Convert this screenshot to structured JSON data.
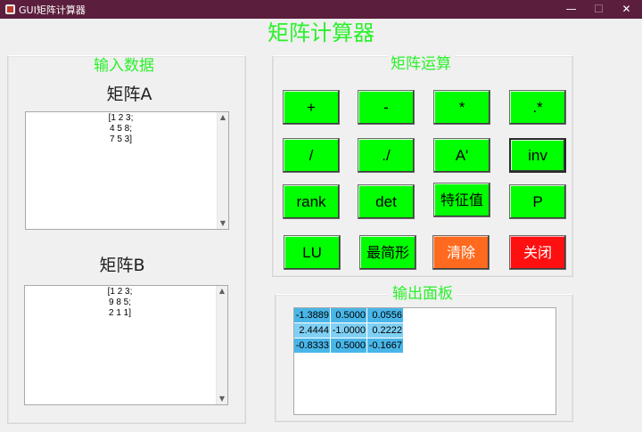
{
  "window": {
    "title": "GUI矩阵计算器",
    "minimize": "—",
    "maximize": "☐",
    "close": "✕"
  },
  "header": {
    "title": "矩阵计算器"
  },
  "input_panel": {
    "title": "输入数据",
    "matrixA_label": "矩阵A",
    "matrixA_value": "[1 2 3;\n4 5 8;\n7 5 3]",
    "matrixB_label": "矩阵B",
    "matrixB_value": "[1 2 3;\n9 8 5;\n2 1 1]"
  },
  "ops_panel": {
    "title": "矩阵运算",
    "buttons": [
      {
        "label": "+"
      },
      {
        "label": "-"
      },
      {
        "label": "*"
      },
      {
        "label": ".*"
      },
      {
        "label": "/"
      },
      {
        "label": "./"
      },
      {
        "label": "A'"
      },
      {
        "label": "inv"
      },
      {
        "label": "rank"
      },
      {
        "label": "det"
      },
      {
        "label": "特征值"
      },
      {
        "label": "P"
      },
      {
        "label": "LU"
      },
      {
        "label": "最简形"
      },
      {
        "label": "清除"
      },
      {
        "label": "关闭"
      }
    ]
  },
  "output_panel": {
    "title": "输出面板",
    "rows": [
      [
        "-1.3889",
        "0.5000",
        "0.0556"
      ],
      [
        "2.4444",
        "-1.0000",
        "0.2222"
      ],
      [
        "-0.8333",
        "0.5000",
        "-0.1667"
      ]
    ]
  },
  "colors": {
    "title_green": "#2bf02b",
    "button_green": "#00ff00",
    "clear_orange": "#ff6a1e",
    "close_red": "#ff1010",
    "titlebar": "#5b1e3c"
  }
}
